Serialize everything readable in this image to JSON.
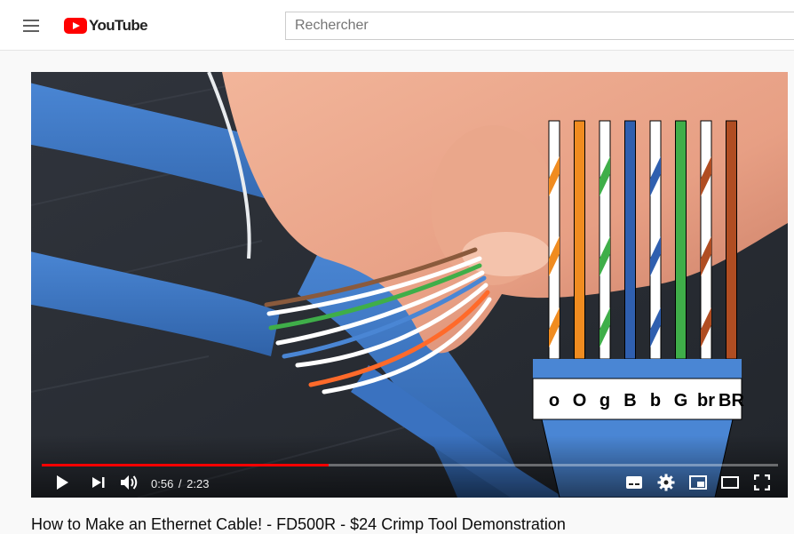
{
  "header": {
    "logo_text": "YouTube",
    "search_placeholder": "Rechercher"
  },
  "player": {
    "current_time": "0:56",
    "duration": "2:23",
    "progress_fraction": 0.39,
    "wiring_labels": [
      "o",
      "O",
      "g",
      "B",
      "b",
      "G",
      "br",
      "BR"
    ],
    "wire_colors": [
      "#f08c20",
      "#f08c20",
      "#3fae49",
      "#2f5faf",
      "#2f5faf",
      "#3fae49",
      "#b04d22",
      "#b04d22"
    ],
    "wire_striped": [
      true,
      false,
      true,
      false,
      true,
      false,
      true,
      false
    ],
    "controls": [
      "play-icon",
      "next-icon",
      "volume-icon",
      "subtitles-icon",
      "settings-icon",
      "miniplayer-icon",
      "theater-icon",
      "fullscreen-icon"
    ]
  },
  "video": {
    "title": "How to Make an Ethernet Cable! - FD500R - $24 Crimp Tool Demonstration"
  }
}
